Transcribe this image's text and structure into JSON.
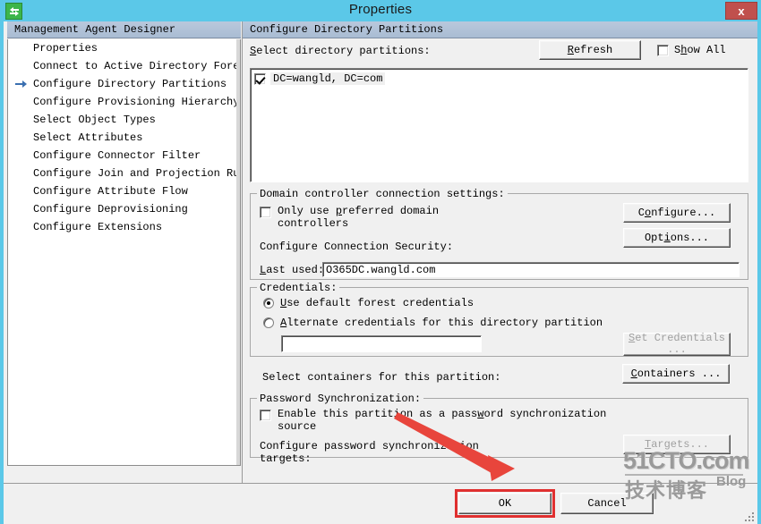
{
  "window": {
    "title": "Properties",
    "icon": "sync-arrows-icon",
    "close_label": "x",
    "accent_color": "#5bc8e8",
    "close_color": "#c0504d"
  },
  "left_pane": {
    "header": "Management Agent Designer",
    "items": [
      {
        "label": "Properties",
        "current": false
      },
      {
        "label": "Connect to Active Directory Forest",
        "current": false
      },
      {
        "label": "Configure Directory Partitions",
        "current": true
      },
      {
        "label": "Configure Provisioning Hierarchy",
        "current": false
      },
      {
        "label": "Select Object Types",
        "current": false
      },
      {
        "label": "Select Attributes",
        "current": false
      },
      {
        "label": "Configure Connector Filter",
        "current": false
      },
      {
        "label": "Configure Join and Projection Rules",
        "current": false
      },
      {
        "label": "Configure Attribute Flow",
        "current": false
      },
      {
        "label": "Configure Deprovisioning",
        "current": false
      },
      {
        "label": "Configure Extensions",
        "current": false
      }
    ]
  },
  "right_pane": {
    "header": "Configure Directory Partitions",
    "select_partitions_label": "Select directory partitions:",
    "refresh_button": "Refresh",
    "show_all_label": "Show All",
    "show_all_checked": false,
    "partitions": [
      {
        "label": "DC=wangld, DC=com",
        "checked": true
      }
    ],
    "dc_group": {
      "caption": "Domain controller connection settings:",
      "only_preferred_label_line1": "Only use preferred domain",
      "only_preferred_label_line2": "controllers",
      "only_preferred_checked": false,
      "connection_security_label": "Configure Connection Security:",
      "last_used_label": "Last used:",
      "last_used_value": "O365DC.wangld.com",
      "configure_button": "Configure...",
      "options_button": "Options..."
    },
    "credentials_group": {
      "caption": "Credentials:",
      "use_default_label": "Use default forest credentials",
      "use_default_selected": true,
      "alternate_label": "Alternate credentials for this directory partition",
      "alternate_selected": false,
      "credentials_value": "",
      "set_credentials_button_line1": "Set Credentials",
      "set_credentials_button_line2": "...",
      "set_credentials_disabled": true
    },
    "containers_row": {
      "label": "Select containers for this partition:",
      "button": "Containers ..."
    },
    "password_sync_group": {
      "caption": "Password Synchronization:",
      "enable_label_line1": "Enable this partition as a password synchronization",
      "enable_label_line2": "source",
      "enable_checked": false,
      "configure_targets_line1": "Configure password synchronization",
      "configure_targets_line2": "targets:",
      "targets_button": "Targets...",
      "targets_disabled": true
    }
  },
  "bottom_bar": {
    "ok_button": "OK",
    "cancel_button": "Cancel",
    "highlight_color": "#e03030"
  },
  "annotation": {
    "arrow_color": "#e8453c",
    "target": "ok-button"
  },
  "watermark": {
    "line1": "51CTO.com",
    "line2": "技术博客",
    "line3": "Blog"
  }
}
